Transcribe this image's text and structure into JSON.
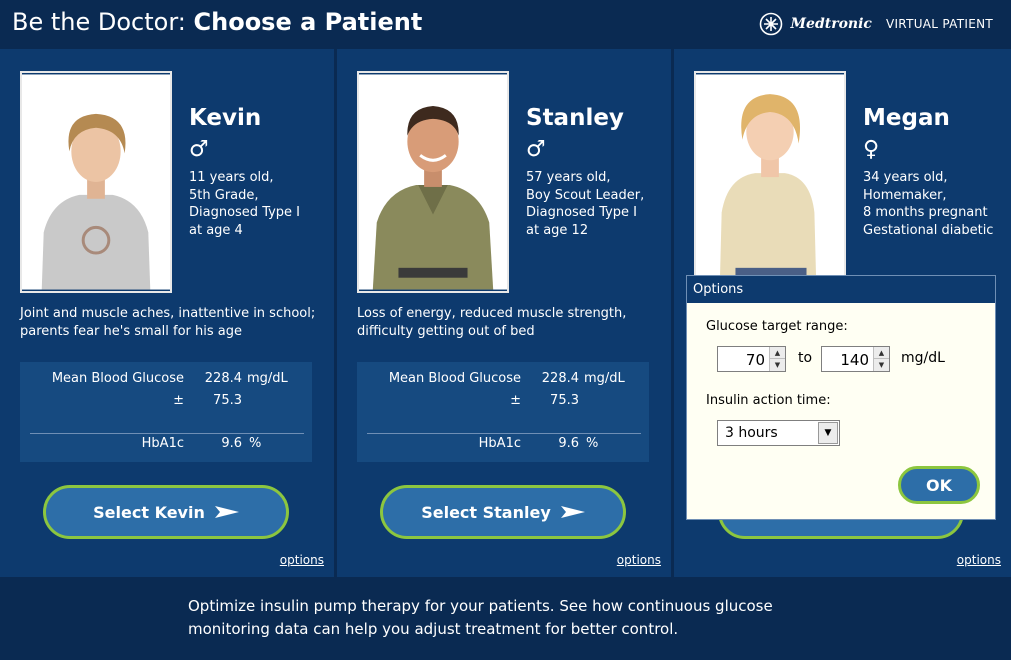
{
  "header": {
    "title_prefix": "Be the Doctor:",
    "title_main": "Choose a Patient",
    "brand": "Medtronic",
    "brand_sub": "VIRTUAL PATIENT",
    "brand_icon": "medtronic-logo-icon"
  },
  "patients": [
    {
      "name": "Kevin",
      "gender_symbol": "♂",
      "info": [
        "11 years old,",
        "5th Grade,",
        "Diagnosed Type I",
        "at age 4"
      ],
      "complaint": "Joint and muscle aches, inattentive in school; parents fear he's small for his age",
      "stats": {
        "mbg_label": "Mean Blood Glucose",
        "mbg_value": "228.4",
        "mbg_unit": "mg/dL",
        "pm": "±",
        "sd": "75.3",
        "hba1c_label": "HbA1c",
        "hba1c_value": "9.6",
        "hba1c_unit": "%"
      },
      "select_label": "Select Kevin",
      "options_label": "options"
    },
    {
      "name": "Stanley",
      "gender_symbol": "♂",
      "info": [
        "57 years old,",
        "Boy Scout Leader,",
        "Diagnosed Type I",
        "at age 12"
      ],
      "complaint": "Loss of energy, reduced muscle strength, difficulty getting out of bed",
      "stats": {
        "mbg_label": "Mean Blood Glucose",
        "mbg_value": "228.4",
        "mbg_unit": "mg/dL",
        "pm": "±",
        "sd": "75.3",
        "hba1c_label": "HbA1c",
        "hba1c_value": "9.6",
        "hba1c_unit": "%"
      },
      "select_label": "Select Stanley",
      "options_label": "options"
    },
    {
      "name": "Megan",
      "gender_symbol": "♀",
      "info": [
        "34 years old,",
        "Homemaker,",
        "8 months pregnant",
        "Gestational diabetic"
      ],
      "options_label": "options"
    }
  ],
  "options_dialog": {
    "title": "Options",
    "glucose_label": "Glucose target range:",
    "low": "70",
    "to": "to",
    "high": "140",
    "unit": "mg/dL",
    "insulin_label": "Insulin action time:",
    "insulin_value": "3 hours",
    "ok_label": "OK"
  },
  "footer": {
    "line1": "Optimize insulin pump therapy for your patients. See how continuous glucose",
    "line2": "monitoring data can help you adjust treatment for better control."
  },
  "colors": {
    "background": "#0a2a52",
    "panel": "#0d3a6e",
    "stats_box": "#164a80",
    "button": "#2d6ea8",
    "button_border": "#8cc63f",
    "dialog_bg": "#fffff3"
  }
}
